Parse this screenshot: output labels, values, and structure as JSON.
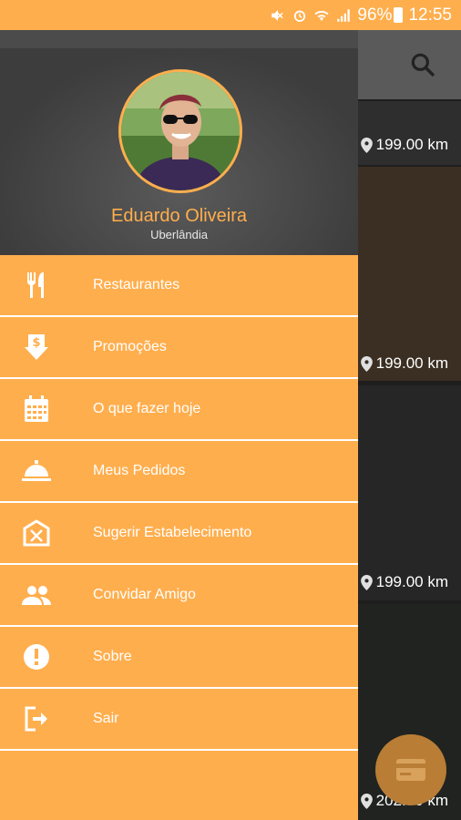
{
  "status": {
    "battery": "96%",
    "time": "12:55"
  },
  "profile": {
    "name": "Eduardo Oliveira",
    "city": "Uberlândia"
  },
  "menu": {
    "items": [
      {
        "label": "Restaurantes",
        "icon": "restaurant-icon"
      },
      {
        "label": "Promoções",
        "icon": "promotion-icon"
      },
      {
        "label": "O que fazer hoje",
        "icon": "calendar-icon"
      },
      {
        "label": "Meus Pedidos",
        "icon": "room-service-icon"
      },
      {
        "label": "Sugerir Estabelecimento",
        "icon": "suggest-place-icon"
      },
      {
        "label": "Convidar Amigo",
        "icon": "invite-friends-icon"
      },
      {
        "label": "Sobre",
        "icon": "info-icon"
      },
      {
        "label": "Sair",
        "icon": "logout-icon"
      }
    ]
  },
  "background": {
    "distances": [
      "199.00 km",
      "199.00 km",
      "199.00 km",
      "202.00 km"
    ]
  },
  "colors": {
    "accent": "#FFAE4D",
    "divider": "#FFFFFF"
  }
}
